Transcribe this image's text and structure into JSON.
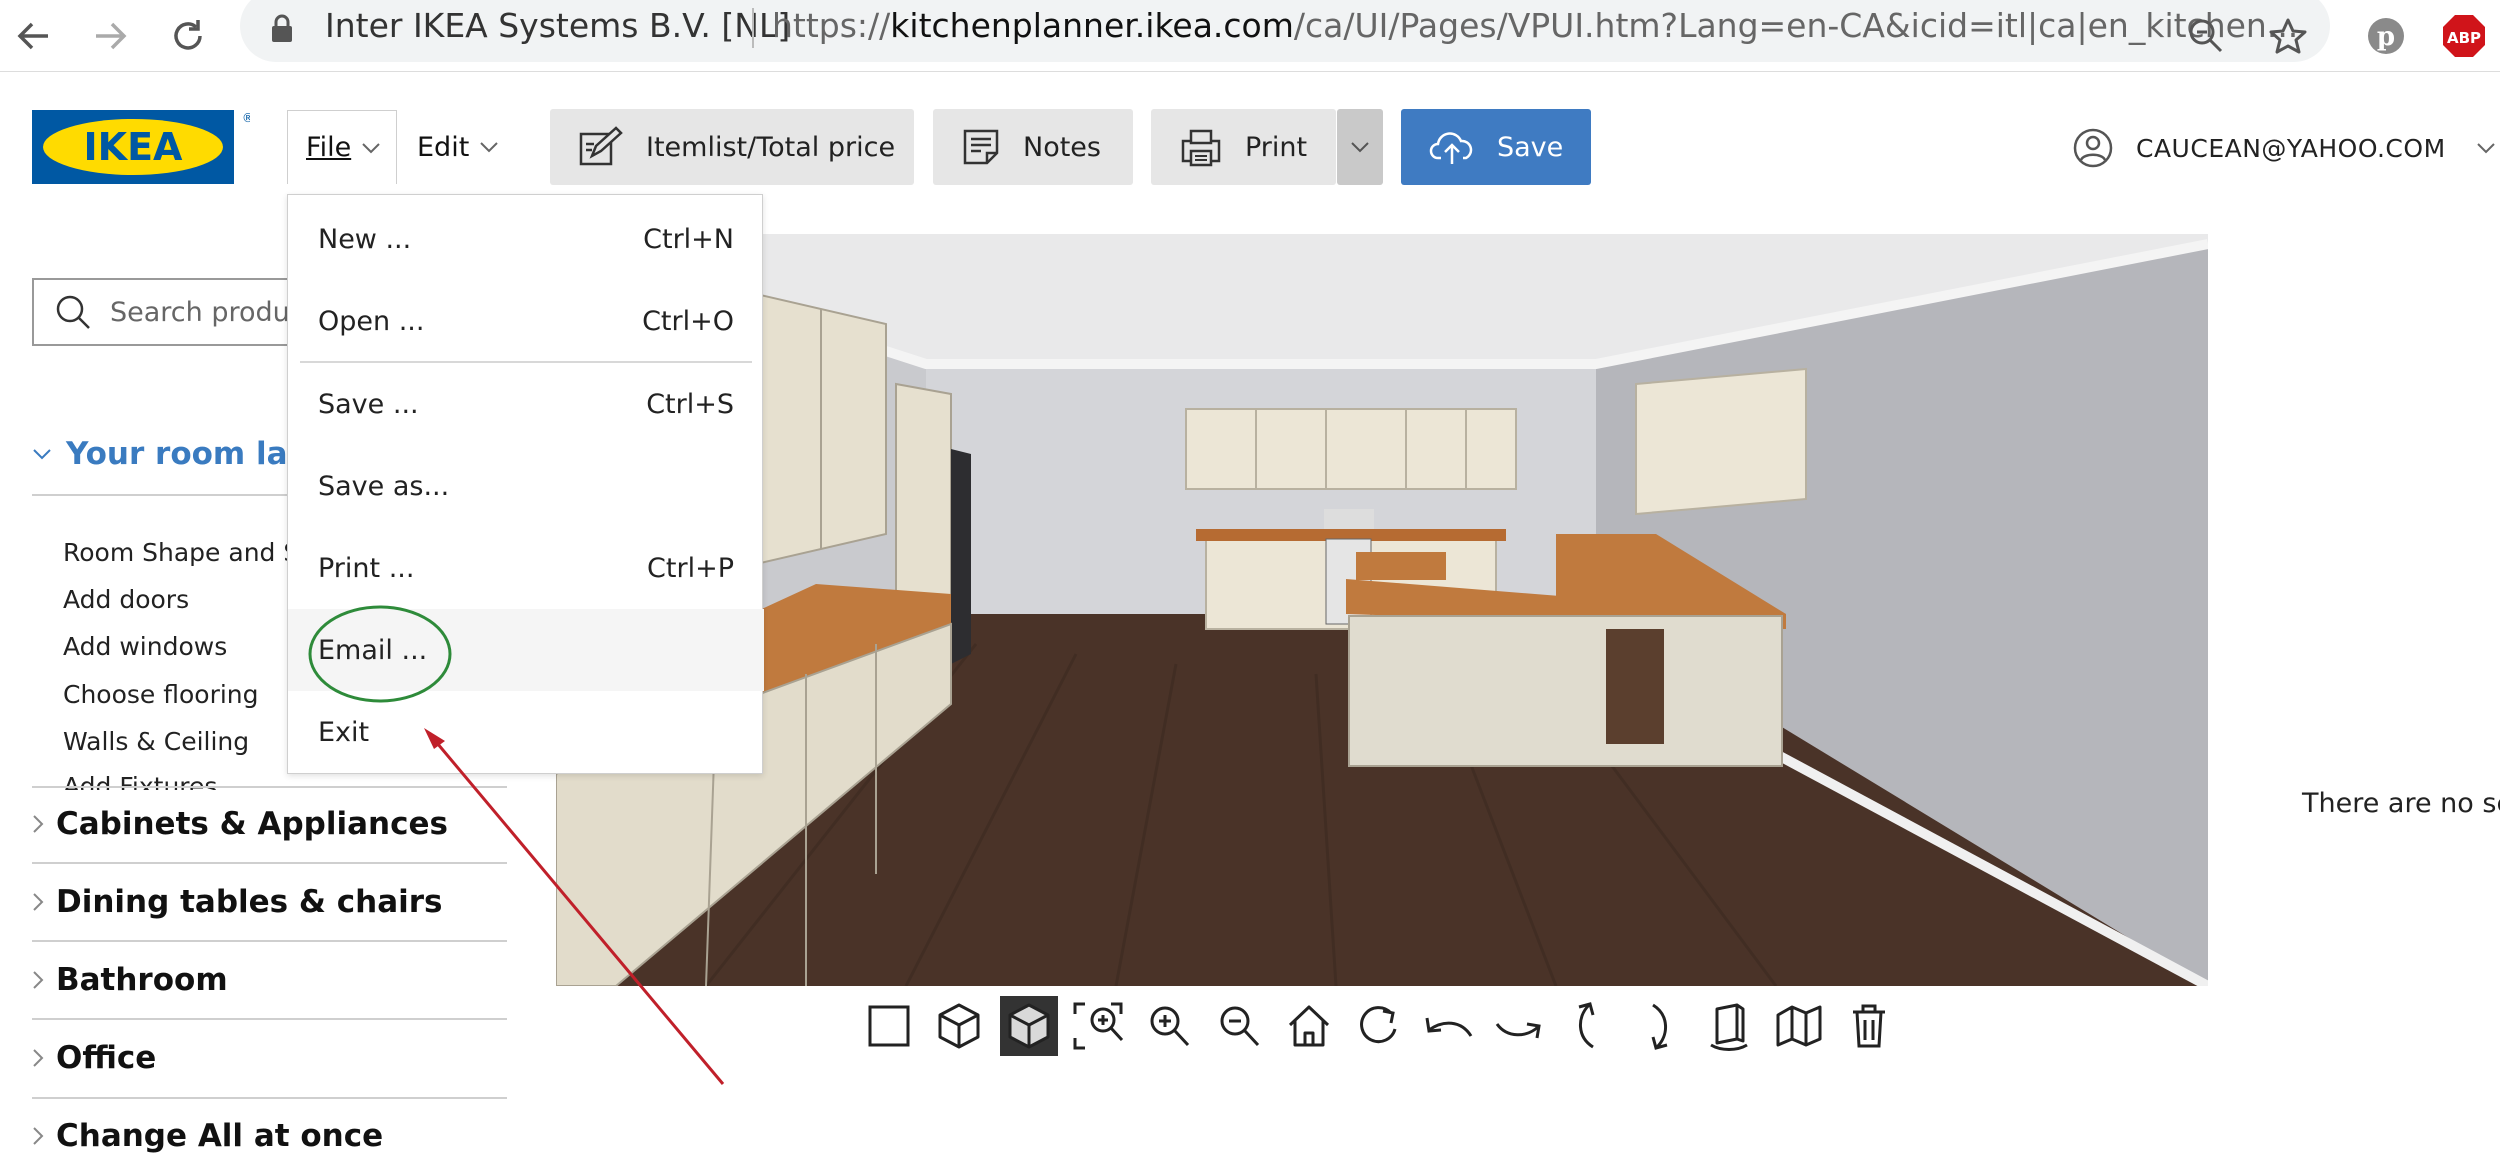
{
  "browser": {
    "site_identity": "Inter IKEA Systems B.V. [NL]",
    "url_domain": "kitchenplanner.ikea.com",
    "url_prefix": "https://",
    "url_path": "/ca/UI/Pages/VPUI.htm?Lang=en-CA&icid=itl|ca|en_kitchen...",
    "extension_abp": "ABP"
  },
  "header": {
    "logo_text": "IKEA",
    "menus": {
      "file": "File",
      "edit": "Edit"
    },
    "toolbar": {
      "itemlist": "Itemlist/Total price",
      "notes": "Notes",
      "print": "Print",
      "save": "Save"
    },
    "user_email": "CAUCEAN@YAHOO.COM"
  },
  "sidebar": {
    "search_placeholder": "Search products",
    "room_section": "Your room layout",
    "room_items": [
      "Room Shape and Size",
      "Add doors",
      "Add windows",
      "Choose flooring",
      "Walls & Ceiling",
      "Add Fixtures"
    ],
    "categories": [
      "Cabinets & Appliances",
      "Dining tables & chairs",
      "Bathroom",
      "Office",
      "Change All at once"
    ]
  },
  "file_menu": {
    "items": [
      {
        "label": "New ...",
        "shortcut": "Ctrl+N"
      },
      {
        "label": "Open ...",
        "shortcut": "Ctrl+O"
      },
      {
        "label": "Save ...",
        "shortcut": "Ctrl+S"
      },
      {
        "label": "Save as...",
        "shortcut": ""
      },
      {
        "label": "Print ...",
        "shortcut": "Ctrl+P"
      },
      {
        "label": "Email ...",
        "shortcut": ""
      },
      {
        "label": "Exit",
        "shortcut": ""
      }
    ],
    "highlighted_index": 5
  },
  "view_toolbar": {
    "tools": [
      "2d-view-icon",
      "3d-view-icon",
      "3d-view-solid-icon",
      "zoom-fit-icon",
      "zoom-in-icon",
      "zoom-out-icon",
      "home-icon",
      "rotate-right-icon",
      "rotate-left-icon",
      "rotate-left-2-icon",
      "tilt-up-icon",
      "tilt-down-icon",
      "wall-toggle-icon",
      "walls-hide-icon",
      "delete-icon"
    ],
    "active_index": 2
  },
  "right_panel": {
    "message": "There are no se"
  },
  "colors": {
    "ikea_blue": "#0058a3",
    "ikea_yellow": "#ffdb00",
    "save_button": "#3f7bc2",
    "section_blue": "#3a7bc0",
    "annotation_circle": "#2e8b3a",
    "annotation_arrow": "#c0202a"
  }
}
